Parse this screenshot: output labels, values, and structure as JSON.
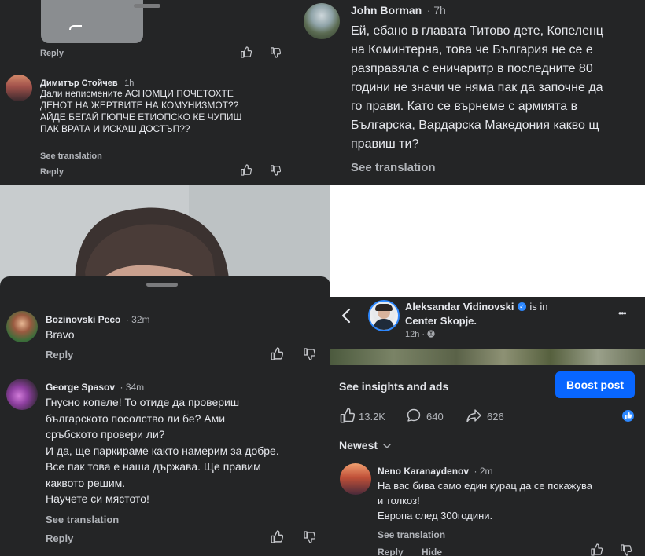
{
  "panel_a": {
    "comment": {
      "author": "Димитър Стойчев",
      "time": "1h",
      "lines": [
        "Дали неписмените АСНОМЦИ ПОЧЕТОХТЕ",
        "ДЕНОТ НА ЖЕРТВИТЕ НА КОМУНИЗМОТ??",
        "АЙДЕ БЕГАЙ ГЮПЧЕ ЕТИОПСКО КЕ ЧУПИШ",
        "ПАК ВРАТА И ИСКАШ ДОСТЪП??"
      ],
      "see_translation": "See translation",
      "reply": "Reply"
    },
    "prev_reply": "Reply"
  },
  "panel_b": {
    "comment": {
      "author": "John Borman",
      "time": "· 7h",
      "lines": [
        "Ей, ебано в главата Титово дете, Копеленц",
        "на Коминтерна, това че България не се е",
        "разправяла с еничаритр в последните 80",
        "години не значи че няма пак да започне да",
        "го прави. Като се върнеме с армията в",
        "Българска, Вардарска Македония какво щ",
        "правиш ти?"
      ],
      "see_translation": "See translation"
    }
  },
  "panel_d": {
    "comments": [
      {
        "author": "Bozinovski Peco",
        "time": "· 32m",
        "lines": [
          "Bravo"
        ],
        "reply": "Reply"
      },
      {
        "author": "George Spasov",
        "time": "· 34m",
        "lines": [
          "Гнусно копеле! То отиде да провериш",
          "българското посолство ли бе? Ами",
          "сръбското провери ли?",
          "И да, ще паркираме както намерим за добре.",
          "Все пак това е наша държава. Ще правим",
          "каквото решим.",
          "Научете си мястото!"
        ],
        "see_translation": "See translation",
        "reply": "Reply"
      }
    ]
  },
  "panel_e": {
    "post": {
      "author": "Aleksandar Vidinovski",
      "is_in": "is in",
      "location": "Center Skopje.",
      "time": "12h ·",
      "more": "•••"
    },
    "insights_label": "See insights and ads",
    "boost_label": "Boost post",
    "stats": {
      "likes": "13.2K",
      "comments": "640",
      "shares": "626"
    },
    "sort_label": "Newest",
    "comment": {
      "author": "Neno Karanaydenov",
      "time": "· 2m",
      "lines": [
        "На вас бива само един курац да се покажува",
        "и толкоз!",
        "Европа след 300години."
      ],
      "see_translation": "See translation",
      "reply": "Reply",
      "hide": "Hide"
    }
  },
  "colors": {
    "panel_bg": "#242526",
    "text": "#e4e6eb",
    "secondary": "#b0b3b8",
    "accent": "#0866ff"
  }
}
